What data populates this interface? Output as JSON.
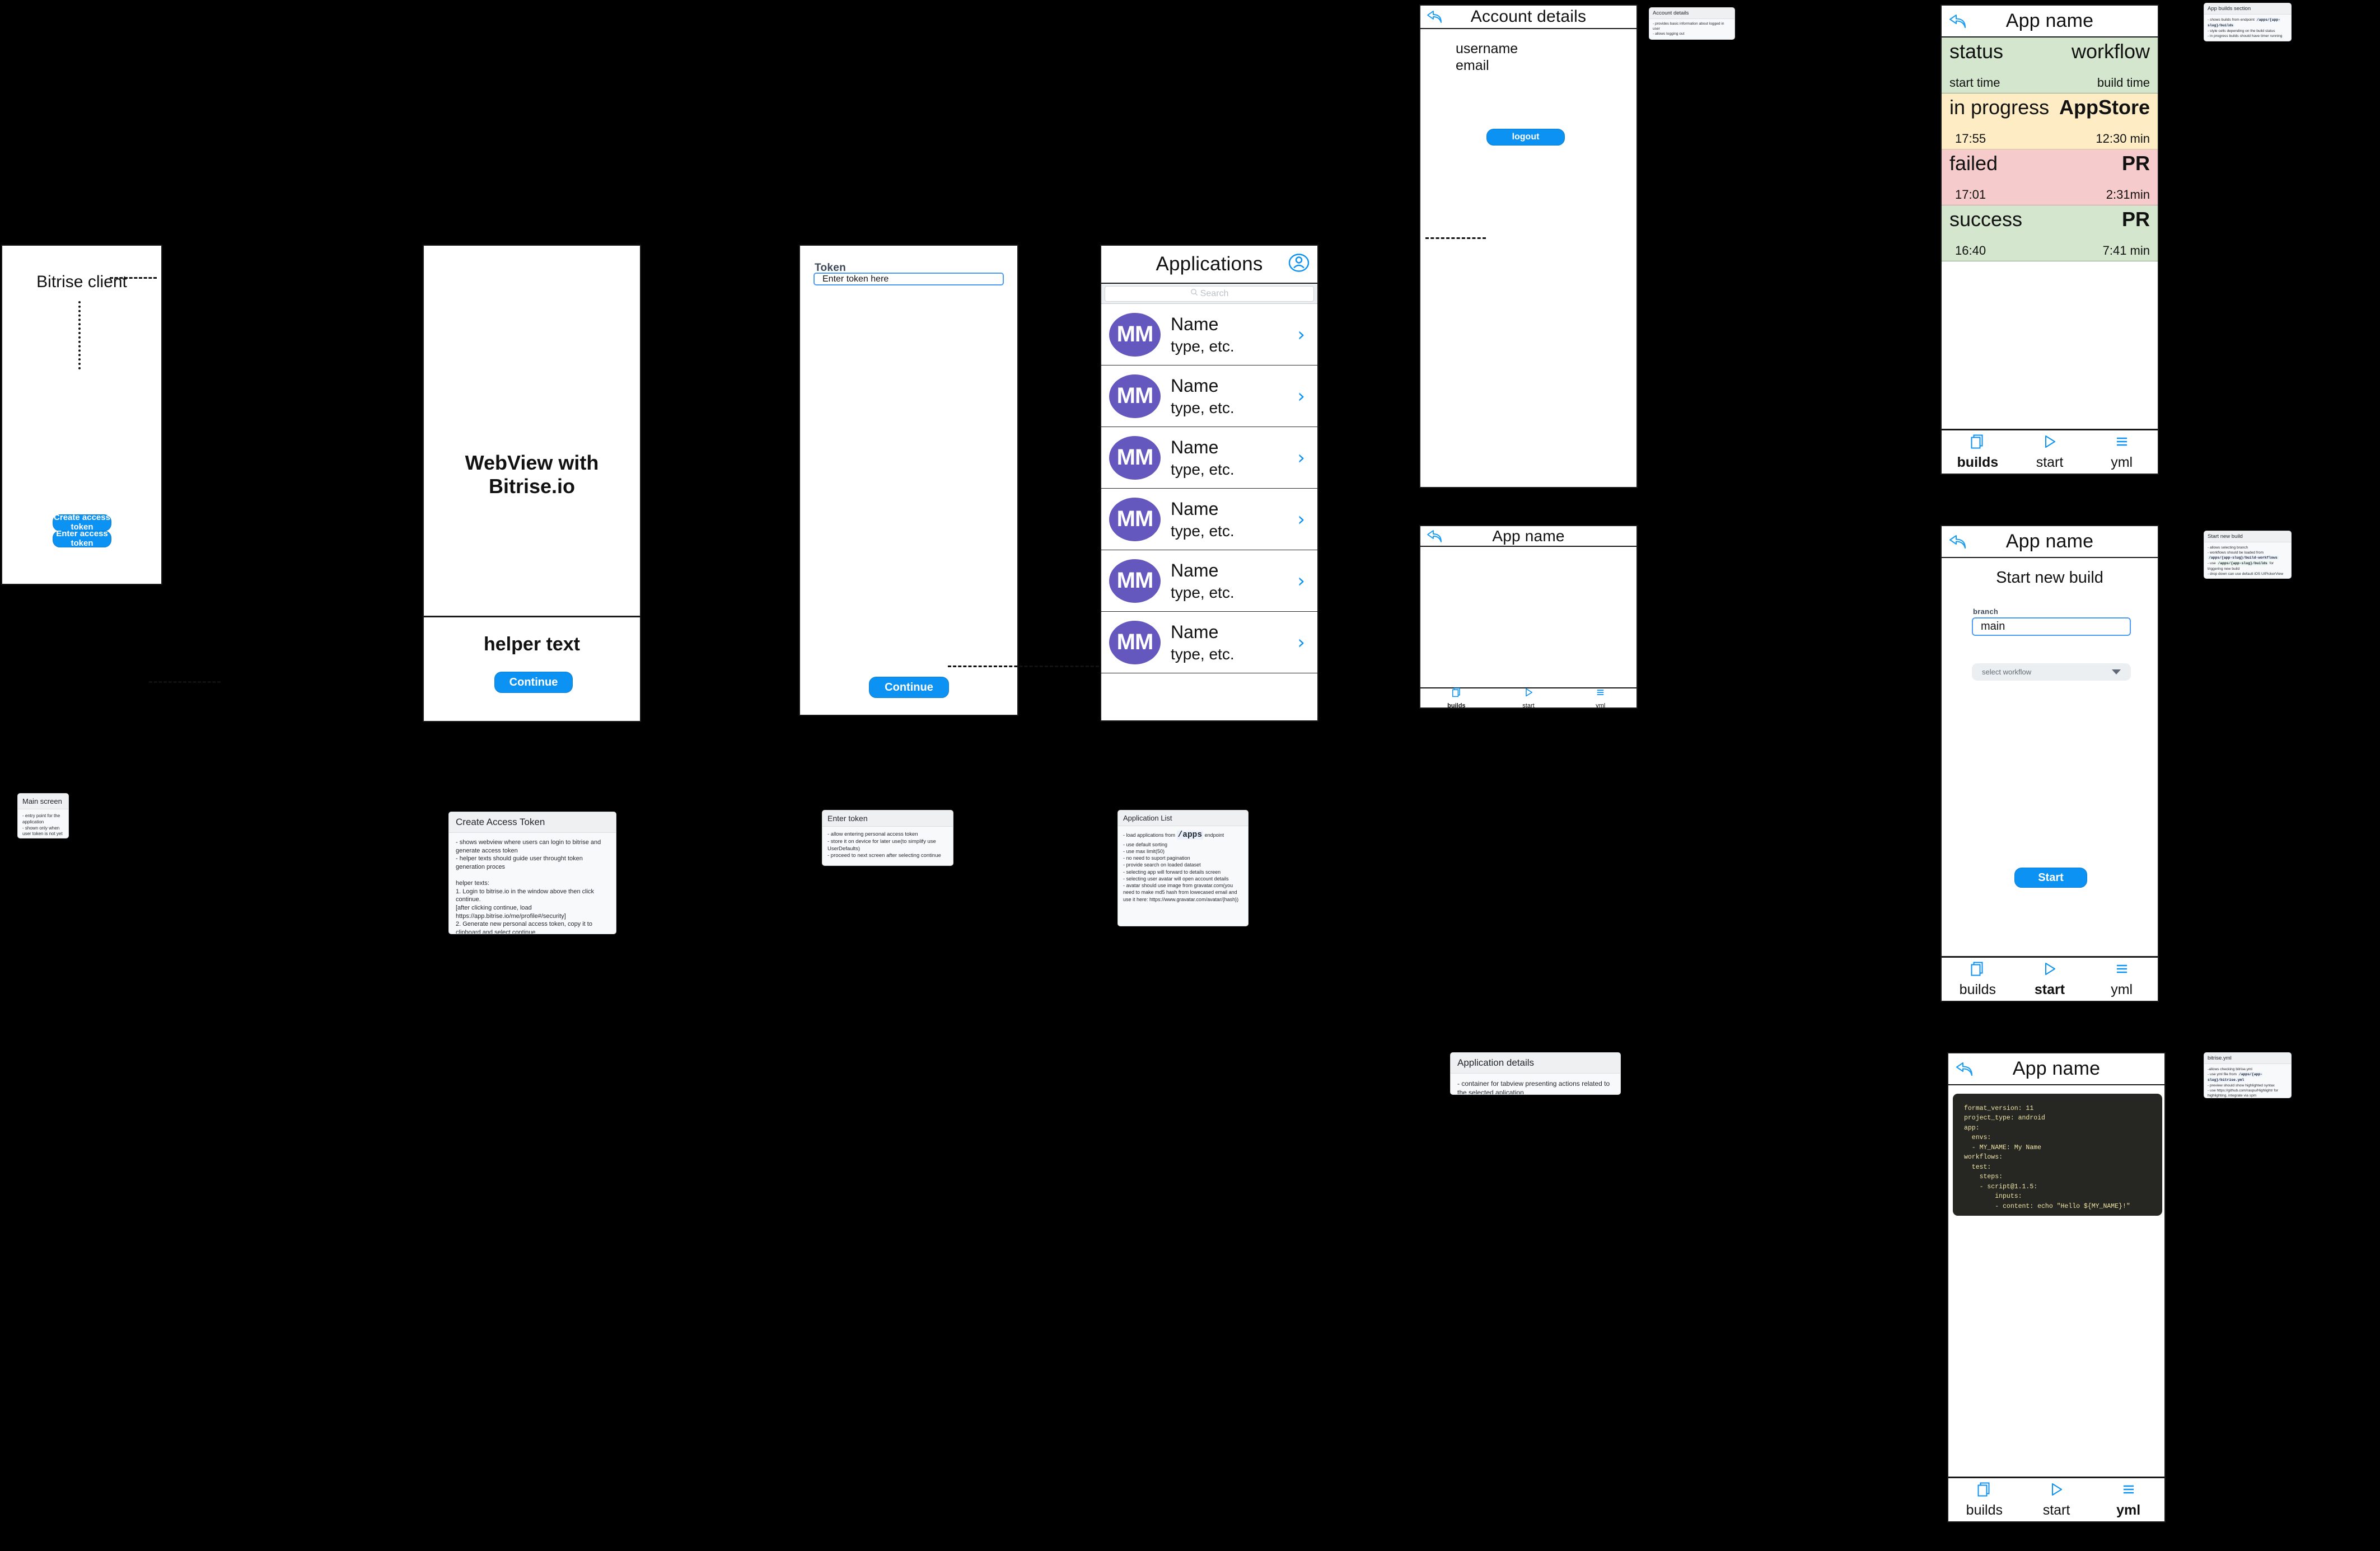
{
  "screens": {
    "main": {
      "title": "Bitrise client",
      "create_token_button": "Create access token",
      "enter_token_button": "Enter access token"
    },
    "webview": {
      "body_text": "WebView with Bitrise.io",
      "helper_text": "helper text",
      "continue_button": "Continue"
    },
    "enter_token": {
      "field_label": "Token",
      "field_value": "Enter token here",
      "continue_button": "Continue"
    },
    "applications": {
      "title": "Applications",
      "account_icon": "person-icon",
      "search_placeholder": "Search",
      "search_icon": "search-icon",
      "rows": [
        {
          "initials": "MM",
          "name": "Name",
          "type": "type, etc."
        },
        {
          "initials": "MM",
          "name": "Name",
          "type": "type, etc."
        },
        {
          "initials": "MM",
          "name": "Name",
          "type": "type, etc."
        },
        {
          "initials": "MM",
          "name": "Name",
          "type": "type, etc."
        },
        {
          "initials": "MM",
          "name": "Name",
          "type": "type, etc."
        },
        {
          "initials": "MM",
          "name": "Name",
          "type": "type, etc."
        }
      ],
      "chevron": "›"
    },
    "account_details": {
      "title": "Account details",
      "username": "username",
      "email": "email",
      "logout_button": "logout"
    },
    "app_builds": {
      "title": "App name",
      "header_status": "status",
      "header_workflow": "workflow",
      "header_start_time": "start time",
      "header_build_time": "build time",
      "builds": [
        {
          "status": "in progress",
          "workflow": "AppStore",
          "start_time": "17:55",
          "build_time": "12:30 min",
          "state": "in-progress"
        },
        {
          "status": "failed",
          "workflow": "PR",
          "start_time": "17:01",
          "build_time": "2:31min",
          "state": "failed"
        },
        {
          "status": "success",
          "workflow": "PR",
          "start_time": "16:40",
          "build_time": "7:41 min",
          "state": "success"
        }
      ]
    },
    "app_details": {
      "title": "App name"
    },
    "start_new_build": {
      "title": "App name",
      "heading": "Start new build",
      "branch_label": "branch",
      "branch_value": "main",
      "workflow_select_value": "select workflow",
      "start_button": "Start"
    },
    "bitrise_yml": {
      "title": "App name",
      "code": "format_version: 11\nproject_type: android\napp:\n  envs:\n  - MY_NAME: My Name\nworkflows:\n  test:\n    steps:\n    - script@1.1.5:\n        inputs:\n        - content: echo \"Hello ${MY_NAME}!\""
    },
    "tabbar": {
      "builds": {
        "label": "builds",
        "icon": "documents-icon"
      },
      "start": {
        "label": "start",
        "icon": "play-icon"
      },
      "yml": {
        "label": "yml",
        "icon": "list-icon"
      }
    }
  },
  "notes": {
    "main_screen": {
      "title": "Main screen",
      "body": "- entry point for the application\n- shown only when user token is not yet saved"
    },
    "create_access_token": {
      "title": "Create Access Token",
      "body": "- shows webview where users can login to bitrise and generate access token\n- helper texts should guide user throught token generation proces\n\nhelper texts:\n1. Login to bitrise.io in the window above then click continue.\n[after clicking continue, load https://app.bitrise.io/me/profile#/security]\n2. Generate new personal access token, copy it to clipboard and select continue\n[continue -> proceed to next screen]"
    },
    "enter_token": {
      "title": "Enter token",
      "body": "- allow entering personal access token\n- store it on device for later use(to simplify use UserDefaults)\n- proceed to next screen after selecting continue"
    },
    "application_list": {
      "title": "Application List",
      "body_1": "- load applications from ",
      "code_1": "/apps",
      "body_2": " endpoint\n- use default sorting\n- use max limit(50)\n- no need to suport pagination\n- provide search on loaded dataset\n- selecting app will forward to details screen\n- selecting user avatar will open account details\n- avatar should use image from gravatar.com(you need to make md5 hash from lowecased email and use it here: https://www.gravatar.com/avatar/{hash})"
    },
    "account_details": {
      "title": "Account details",
      "body": "- provides basic information about logged in user\n- allows logging out"
    },
    "app_builds_section": {
      "title": "App builds section",
      "body_1": "- shows builds from endpoint ",
      "code_1": "/apps/{app-slug}/builds",
      "body_2": "\n- style cells depending on the build status\n- in progress builds should have timer running"
    },
    "application_details": {
      "title": "Application details",
      "body": "- container for tabview presenting actions related to the selected aplication"
    },
    "start_new_build": {
      "title": "Start new build",
      "body_1": "- allows selecting branch\n- workflows should be loaded from ",
      "code_1": "/apps/{app-slug}/build-workflows",
      "body_2": "\n- use ",
      "code_2": "/apps/{app-slug}/builds",
      "body_3": " for triggering new build\n- drop down can use default iOS UIPickerView"
    },
    "bitrise_yml": {
      "title": "bitrise.yml",
      "body_1": "-allows checking bitrise.yml\n- use yml file from ",
      "code_1": "/apps/{app-slug}/bitrise.yml",
      "body_2": "\n- preview should show highlighted syntax\n- use https://github.com/raspu/Highlightr for highlighting, integrate via spm"
    }
  },
  "colors": {
    "accent_blue": "#0c92f2",
    "avatar_purple": "#6458bf",
    "status_success_bg": "#d4e6cd",
    "status_failed_bg": "#f5cbcb",
    "status_inprogress_bg": "#fdecc4",
    "background": "#000000"
  }
}
